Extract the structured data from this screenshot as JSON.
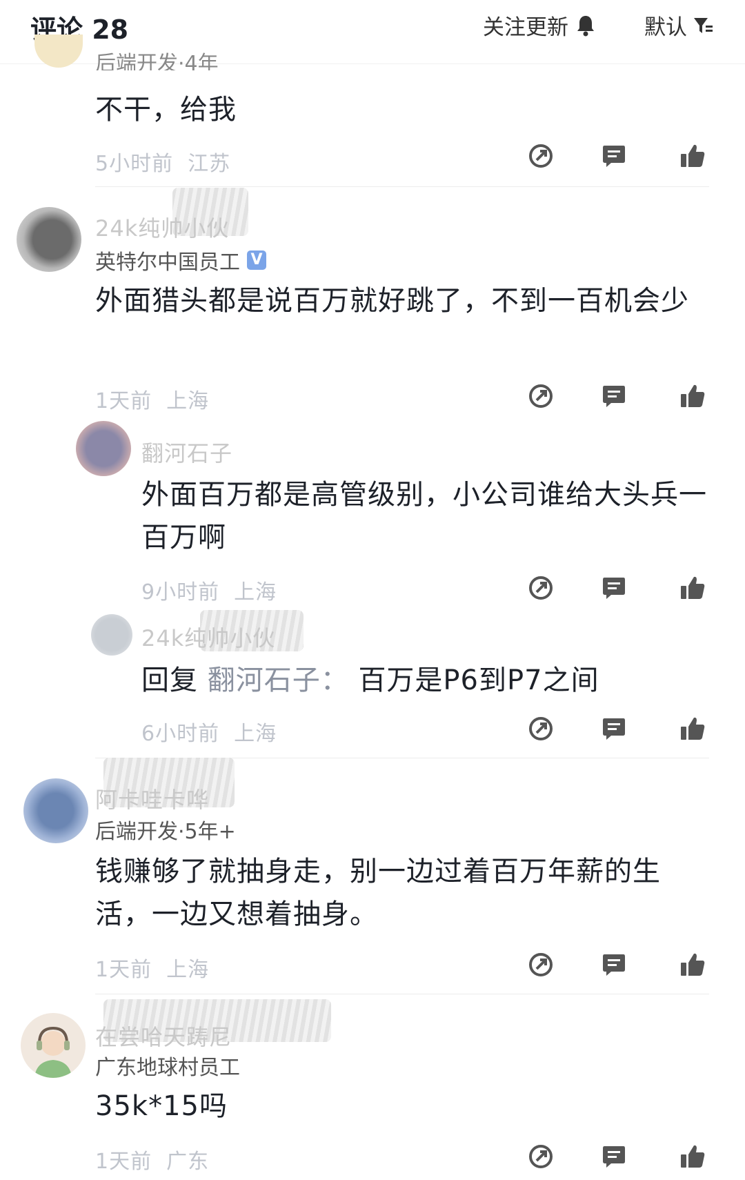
{
  "header": {
    "title": "评论 28",
    "follow_label": "关注更新",
    "sort_label": "默认"
  },
  "comments": [
    {
      "subtitle": "后端开发·4年",
      "text": "不干，给我",
      "time": "5小时前",
      "location": "江苏"
    },
    {
      "username": "24k纯帅小伙",
      "subtitle": "英特尔中国员工",
      "badge": "V",
      "text": "外面猎头都是说百万就好跳了，不到一百机会少",
      "time": "1天前",
      "location": "上海"
    },
    {
      "username": "翻河石子",
      "text": "外面百万都是高管级别，小公司谁给大头兵一百万啊",
      "time": "9小时前",
      "location": "上海"
    },
    {
      "username": "24k纯帅小伙",
      "reply_prefix": "回复",
      "reply_to": "翻河石子：",
      "text": "百万是P6到P7之间",
      "time": "6小时前",
      "location": "上海"
    },
    {
      "username": "阿卡哇卡哗",
      "subtitle": "后端开发·5年+",
      "text": "钱赚够了就抽身走，别一边过着百万年薪的生活，一边又想着抽身。",
      "time": "1天前",
      "location": "上海"
    },
    {
      "username": "在尝哈天踌尼",
      "subtitle": "广东地球村员工",
      "text": "35k*15吗",
      "time": "1天前",
      "location": "广东"
    }
  ],
  "icons": {
    "share": "share-icon",
    "reply": "comment-icon",
    "like": "thumbs-up-icon",
    "bell": "bell-icon",
    "filter": "filter-icon"
  },
  "colors": {
    "text": "#1d2129",
    "muted": "#c0c4cc",
    "icon": "#555555",
    "badge": "#7ba4e8"
  }
}
